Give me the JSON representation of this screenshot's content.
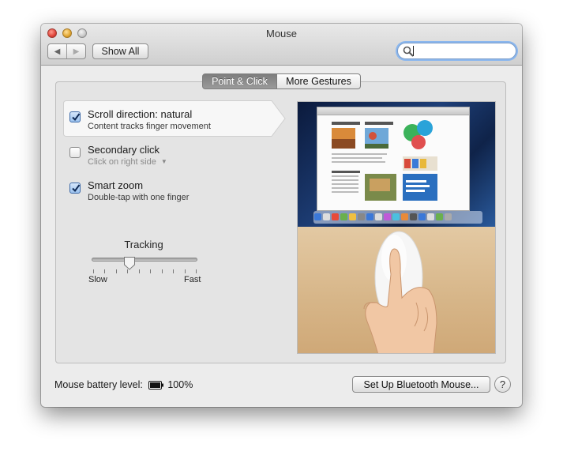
{
  "window": {
    "title": "Mouse"
  },
  "toolbar": {
    "back_icon": "chevron-left-icon",
    "forward_icon": "chevron-right-icon",
    "show_all_label": "Show All",
    "search": {
      "value": "",
      "icon": "magnifier-icon"
    }
  },
  "tabs": [
    {
      "label": "Point & Click",
      "selected": true
    },
    {
      "label": "More Gestures",
      "selected": false
    }
  ],
  "options": [
    {
      "title": "Scroll direction: natural",
      "subtitle": "Content tracks finger movement",
      "checked": true,
      "highlighted": true
    },
    {
      "title": "Secondary click",
      "subtitle": "Click on right side",
      "checked": false,
      "subtitle_is_dropdown": true
    },
    {
      "title": "Smart zoom",
      "subtitle": "Double-tap with one finger",
      "checked": true
    }
  ],
  "tracking": {
    "label": "Tracking",
    "min_label": "Slow",
    "max_label": "Fast",
    "tick_count": 10,
    "value_fraction": 0.35
  },
  "footer": {
    "battery_label": "Mouse battery level:",
    "battery_value": "100%",
    "battery_icon": "battery-full-icon",
    "setup_button_label": "Set Up Bluetooth Mouse...",
    "help_label": "?"
  },
  "colors": {
    "selected_tab": "#8a8a8a",
    "checkbox_checked": "#9cc2ef",
    "search_focus": "#8bb7ee"
  }
}
